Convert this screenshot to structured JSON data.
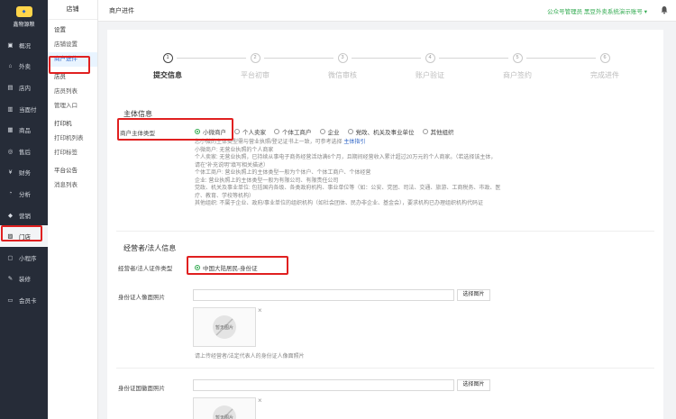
{
  "sidebar": {
    "logo_text": "鑫物源粮",
    "items": [
      {
        "label": "概况",
        "icon": "overview-icon"
      },
      {
        "label": "外卖",
        "icon": "takeout-icon"
      },
      {
        "label": "店内",
        "icon": "store-icon"
      },
      {
        "label": "当面付",
        "icon": "facepay-icon"
      },
      {
        "label": "商品",
        "icon": "goods-icon"
      },
      {
        "label": "售后",
        "icon": "aftersale-icon"
      },
      {
        "label": "财务",
        "icon": "finance-icon"
      },
      {
        "label": "分析",
        "icon": "analysis-icon"
      },
      {
        "label": "营销",
        "icon": "marketing-icon"
      },
      {
        "label": "门店",
        "icon": "shop-icon"
      },
      {
        "label": "小程序",
        "icon": "miniapp-icon"
      },
      {
        "label": "装修",
        "icon": "decorate-icon"
      },
      {
        "label": "会员卡",
        "icon": "membercard-icon"
      }
    ]
  },
  "subnav": {
    "title": "店铺",
    "groups": [
      {
        "label": "设置",
        "items": [
          "店铺设置",
          "商户进件"
        ]
      },
      {
        "label": "店员",
        "items": [
          "店员列表",
          "管理入口"
        ]
      },
      {
        "label": "打印机",
        "items": [
          "打印机列表",
          "打印标签"
        ]
      },
      {
        "label": "平台公告",
        "items": [
          "消息列表"
        ]
      }
    ]
  },
  "topbar": {
    "title": "商户进件",
    "account": "公众号管理员 黑豆外卖系统演示账号"
  },
  "steps": [
    {
      "num": "1",
      "label": "提交信息"
    },
    {
      "num": "2",
      "label": "平台初审"
    },
    {
      "num": "3",
      "label": "微信审核"
    },
    {
      "num": "4",
      "label": "账户验证"
    },
    {
      "num": "5",
      "label": "商户签约"
    },
    {
      "num": "6",
      "label": "完成进件"
    }
  ],
  "subject": {
    "section_title": "主体信息",
    "type_label": "商户主体类型",
    "options": [
      "小微商户",
      "个人卖家",
      "个体工商户",
      "企业",
      "党政、机关及事业单位",
      "其他组织"
    ],
    "help_intro": "您小微的主体类型需与营业执照/登记证书上一致，可参考选择",
    "help_link": "主体指引",
    "help_lines": [
      "小微商户: 无营业执照的个人商家",
      "个人卖家: 无营业执照，已持续从事电子商务经营活动满6个月，且期间经营收入累计超过20万元的个人商家。（若选择该主体，请在“补充说明”填写相关描述）",
      "个体工商户: 营业执照上的主体类型一般为个体户、个体工商户、个体经营",
      "企业: 营业执照上的主体类型一般为有限公司、有限责任公司",
      "党政、机关及事业单位: 包括国内各级、各类政府机构、事业单位等（如：公安、党团、司法、交通、旅游、工商税务、市政、医疗、教育、学校等机构）",
      "其他组织: 不属于企业、政府/事业单位的组织机构（如社会团体、民办非企业、基金会），要求机构已办理组织机构代码证"
    ]
  },
  "operator": {
    "section_title": "经营者/法人信息",
    "id_type_label": "经营者/法人证件类型",
    "id_type_value": "中国大陆居民-身份证",
    "portrait_label": "身份证人像面照片",
    "emblem_label": "身份证国徽面照片",
    "select_image_label": "选择图片",
    "thumb_text": "暂无图片",
    "portrait_hint": "请上传经营者/法定代表人的身份证人像面照片"
  }
}
